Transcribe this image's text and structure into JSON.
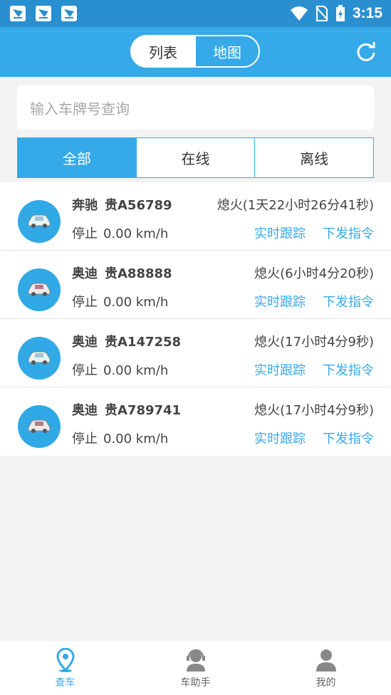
{
  "status_bar": {
    "time": "3:15"
  },
  "header": {
    "segments": [
      "列表",
      "地图"
    ],
    "active_segment": "列表"
  },
  "search": {
    "placeholder": "输入车牌号查询"
  },
  "filters": [
    "全部",
    "在线",
    "离线"
  ],
  "vehicles": [
    {
      "brand": "奔驰",
      "plate": "贵A56789",
      "state": "熄火(1天22小时26分41秒)",
      "speed_status": "停止",
      "speed": "0.00 km/h",
      "track_label": "实时跟踪",
      "command_label": "下发指令"
    },
    {
      "brand": "奥迪",
      "plate": "贵A88888",
      "state": "熄火(6小时4分20秒)",
      "speed_status": "停止",
      "speed": "0.00 km/h",
      "track_label": "实时跟踪",
      "command_label": "下发指令"
    },
    {
      "brand": "奥迪",
      "plate": "贵A147258",
      "state": "熄火(17小时4分9秒)",
      "speed_status": "停止",
      "speed": "0.00 km/h",
      "track_label": "实时跟踪",
      "command_label": "下发指令"
    },
    {
      "brand": "奥迪",
      "plate": "贵A789741",
      "state": "熄火(17小时4分9秒)",
      "speed_status": "停止",
      "speed": "0.00 km/h",
      "track_label": "实时跟踪",
      "command_label": "下发指令"
    }
  ],
  "bottom_nav": [
    {
      "label": "查车",
      "icon": "location-pin-icon",
      "active": true
    },
    {
      "label": "车助手",
      "icon": "headset-agent-icon",
      "active": false
    },
    {
      "label": "我的",
      "icon": "user-icon",
      "active": false
    }
  ],
  "colors": {
    "primary": "#36a9e8",
    "status_bar": "#2a8fcf",
    "background": "#f3f3f3"
  }
}
